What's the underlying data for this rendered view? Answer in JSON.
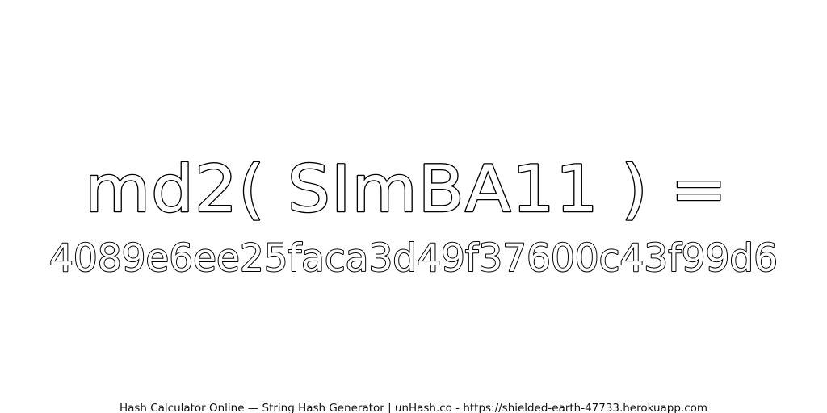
{
  "headline": "md2( SImBA11 ) =",
  "digest": "4089e6ee25faca3d49f37600c43f99d6",
  "footer": "Hash Calculator Online — String Hash Generator | unHash.co - https://shielded-earth-47733.herokuapp.com"
}
